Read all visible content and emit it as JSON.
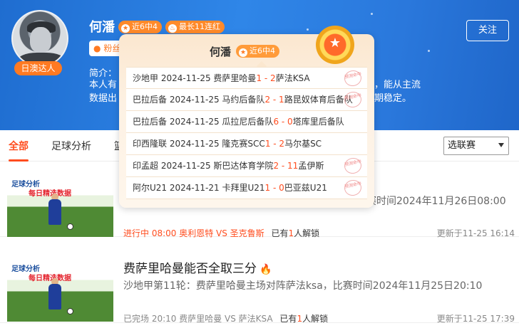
{
  "profile": {
    "name": "何潘",
    "role_badge": "日澳达人",
    "badges": [
      "近6中4",
      "最长11连红"
    ],
    "fans_label": "粉丝",
    "intro_label": "简介：",
    "intro_lines": [
      "本人有",
      "数据出"
    ],
    "intro_right_lines": [
      "析，能从主流",
      "长期稳定。"
    ],
    "follow_label": "关注"
  },
  "tabs": {
    "items": [
      "全部",
      "足球分析",
      "篮"
    ],
    "active_index": 0,
    "league_select": "选联赛"
  },
  "articles": [
    {
      "thumb_line1": "足球分析",
      "thumb_line2": "每日精选数据",
      "title": "",
      "desc": "赛时间2024年11月26日08:00",
      "status_prefix": "进行中 08:00 奥利恩特 VS 圣克鲁斯",
      "unlock_text": "已有",
      "unlock_count": "1",
      "unlock_suffix": "人解锁",
      "updated": "更新于11-25 16:14"
    },
    {
      "thumb_line1": "足球分析",
      "thumb_line2": "每日精选数据",
      "title": "费萨里哈曼能否全取三分",
      "desc": "沙地甲第11轮：费萨里哈曼主场对阵萨法ksa，比赛时间2024年11月25日20:10",
      "status_prefix": "已完场 20:10 费萨里哈曼 VS 萨法KSA",
      "unlock_text": "已有",
      "unlock_count": "1",
      "unlock_suffix": "人解锁",
      "updated": "更新于11-25 17:39"
    }
  ],
  "popover": {
    "title": "何潘",
    "badge": "近6中4",
    "stamp_text": "预测命中",
    "matches": [
      {
        "league": "沙地甲",
        "date": "2024-11-25",
        "home": "费萨里哈曼",
        "home_score": "1",
        "sep": " - ",
        "away_score": "2",
        "away": "萨法KSA",
        "hit": true
      },
      {
        "league": "巴拉后备",
        "date": "2024-11-25",
        "home": "马约后备队",
        "home_score": "2",
        "sep": " - ",
        "away_score": "1",
        "away": "路昆奴体育后备队",
        "hit": true
      },
      {
        "league": "巴拉后备",
        "date": "2024-11-25",
        "home": "瓜拉尼后备队",
        "home_score": "6",
        "sep": " - ",
        "away_score": "0",
        "away": "塔库里后备队",
        "hit": false
      },
      {
        "league": "印西隆联",
        "date": "2024-11-25",
        "home": "隆克赛SCC",
        "home_score": "1",
        "sep": " - ",
        "away_score": "2",
        "away": "马尔基SC",
        "hit": false
      },
      {
        "league": "印孟超",
        "date": "2024-11-25",
        "home": "斯巴达体育学院",
        "home_score": "2",
        "sep": " - ",
        "away_score": "11",
        "away": "孟伊斯",
        "hit": true
      },
      {
        "league": "阿尔U21",
        "date": "2024-11-21",
        "home": "卡拜里U21",
        "home_score": "1",
        "sep": " - ",
        "away_score": "0",
        "away": "巴亚兹U21",
        "hit": true
      }
    ]
  },
  "colors": {
    "accent": "#ff4d1f",
    "badge_orange": "#ff8a2a",
    "banner_blue": "#2f86e8"
  }
}
